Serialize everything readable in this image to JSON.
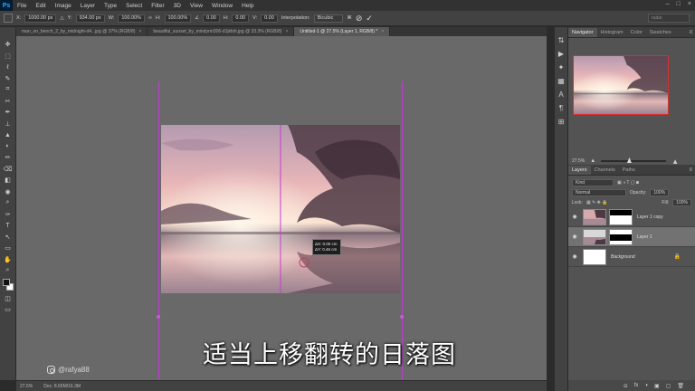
{
  "app": {
    "logo": "Ps"
  },
  "menu": [
    "File",
    "Edit",
    "Image",
    "Layer",
    "Type",
    "Select",
    "Filter",
    "3D",
    "View",
    "Window",
    "Help"
  ],
  "window_controls": [
    "–",
    "□",
    "×"
  ],
  "options_bar": {
    "x_label": "X:",
    "x_value": "1000.00 px",
    "y_label": "Y:",
    "y_value": "934.00 px",
    "w_label": "W:",
    "w_value": "100.00%",
    "h_label": "H:",
    "h_value": "100.00%",
    "angle_value": "0.00",
    "h_skew_label": "H:",
    "h_skew_value": "0.00",
    "v_skew_label": "V:",
    "v_skew_value": "0.00",
    "interpolation_label": "Interpolation:",
    "interpolation_value": "Bicubic",
    "search_placeholder": "radar"
  },
  "doc_tabs": [
    {
      "label": "man_on_bench_2_by_midnight-d4...jpg @ 37% (RGB/8)",
      "active": false
    },
    {
      "label": "beautiful_sunset_by_mindyrm306-d1jkfsh.jpg @ 33.3% (RGB/8)",
      "active": false
    },
    {
      "label": "Untitled-1 @ 27.5% (Layer 1, RGB/8) *",
      "active": true
    }
  ],
  "tools": [
    "✥",
    "⬚",
    "ℓ",
    "✎",
    "⌗",
    "✂",
    "✒",
    "⊥",
    "▲",
    "◐",
    "✏",
    "⌫",
    "◧",
    "◉",
    "⌕",
    "✑",
    "T",
    "↖",
    "▭",
    "✋",
    "⌕"
  ],
  "measure_tooltip": {
    "dx": "ΔX:  0.00 cm",
    "dy": "ΔY:  0.46 cm"
  },
  "status": {
    "zoom": "27.5%",
    "doc": "Doc: 8.65M/16.3M"
  },
  "watermark": "@rafya88",
  "subtitle": "适当上移翻转的日落图",
  "side_strip_icons": [
    "⇅",
    "▶",
    "✦",
    "▦",
    "A",
    "¶",
    "⊞"
  ],
  "navigator": {
    "tabs": [
      "Navigator",
      "Histogram",
      "Color",
      "Swatches"
    ],
    "zoom": "27.5%"
  },
  "layers_panel": {
    "tabs": [
      "Layers",
      "Channels",
      "Paths"
    ],
    "kind_label": "Kind",
    "blend_mode": "Normal",
    "opacity_label": "Opacity:",
    "opacity_value": "100%",
    "lock_label": "Lock:",
    "fill_label": "Fill:",
    "fill_value": "100%",
    "layers": [
      {
        "name": "Layer 1 copy",
        "selected": false
      },
      {
        "name": "Layer 1",
        "selected": true
      },
      {
        "name": "Background",
        "selected": false
      }
    ],
    "footer_icons": [
      "⊝",
      "fx",
      "◑",
      "▣",
      "▢",
      "🗑"
    ]
  },
  "colors": {
    "guide": "#c33cd6",
    "accent": "#31a8ff",
    "nav_frame": "#d73030"
  }
}
